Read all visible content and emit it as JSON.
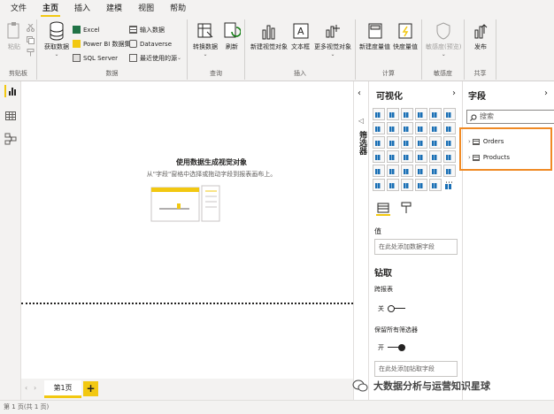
{
  "menu": {
    "items": [
      "文件",
      "主页",
      "插入",
      "建模",
      "视图",
      "帮助"
    ],
    "active": "主页"
  },
  "ribbon": {
    "clipboard": {
      "paste": "粘贴",
      "group": "剪贴板"
    },
    "data": {
      "get_data": "获取数据",
      "excel": "Excel",
      "powerbi": "Power BI 数据集",
      "sql": "SQL Server",
      "enter_data": "输入数据",
      "dataverse": "Dataverse",
      "recent": "最近使用的源",
      "group": "数据"
    },
    "queries": {
      "transform": "转换数据",
      "refresh": "刷新",
      "group": "查询"
    },
    "insert": {
      "new_visual": "新建视觉对象",
      "textbox": "文本框",
      "more_visuals": "更多视觉对象",
      "group": "插入"
    },
    "calc": {
      "new_measure": "新建度量值",
      "quick_measure": "快度量值",
      "group": "计算"
    },
    "sensitivity": {
      "label": "敏感度(预览)",
      "group": "敏感度"
    },
    "share": {
      "publish": "发布",
      "group": "共享"
    }
  },
  "canvas": {
    "title": "使用数据生成视觉对象",
    "subtitle": "从\"字段\"窗格中选择或拖动字段到报表画布上。"
  },
  "pages": {
    "tab": "第1页",
    "add": "+"
  },
  "status": {
    "text": "第 1 页(共 1 页)"
  },
  "viz_pane": {
    "title": "可视化",
    "strip_label": "筛选器",
    "values_label": "值",
    "values_placeholder": "在此处添加数据字段",
    "drill_heading": "钻取",
    "cross_report": "跨报表",
    "off_label": "关",
    "keep_filters": "保留所有筛选器",
    "on_label": "开",
    "drill_placeholder": "在此处添加钻取字段"
  },
  "fields_pane": {
    "title": "字段",
    "search_placeholder": "搜索",
    "tables": [
      "Orders",
      "Products"
    ]
  },
  "watermark": {
    "text": "大数据分析与运营知识星球"
  },
  "colors": {
    "accent": "#f2c811",
    "highlight": "#f08a24",
    "ribbon_bg": "#f3f2f1"
  }
}
